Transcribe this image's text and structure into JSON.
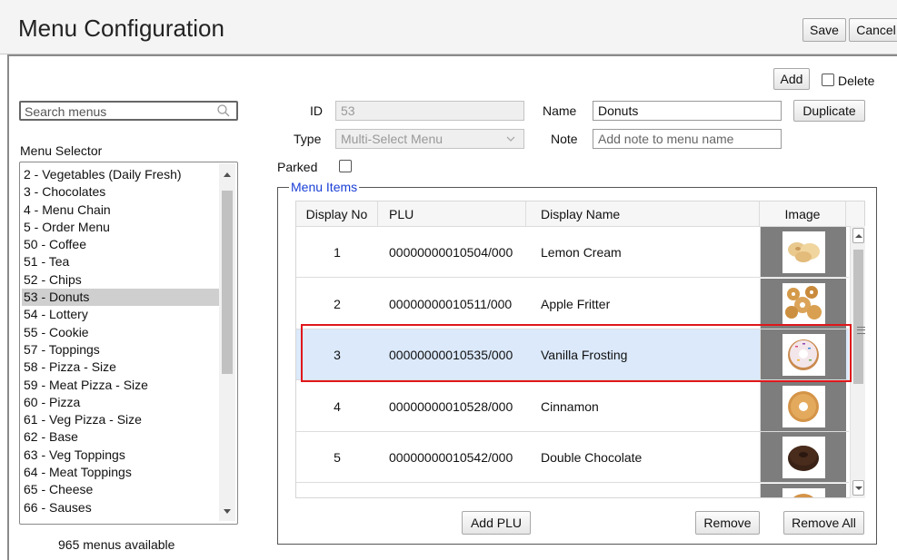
{
  "header": {
    "title": "Menu Configuration",
    "save_label": "Save",
    "cancel_label": "Cancel"
  },
  "sidebar": {
    "search_placeholder": "Search menus",
    "selector_label": "Menu Selector",
    "selected_index": 7,
    "menus": [
      "2 - Vegetables (Daily Fresh)",
      "3 - Chocolates",
      "4 - Menu Chain",
      "5 - Order Menu",
      "50 - Coffee",
      "51 - Tea",
      "52 - Chips",
      "53 - Donuts",
      "54 - Lottery",
      "55 - Cookie",
      "57 - Toppings",
      "58 - Pizza - Size",
      "59 - Meat Pizza - Size",
      "60 - Pizza",
      "61 - Veg Pizza - Size",
      "62 - Base",
      "63 - Veg Toppings",
      "64 - Meat Toppings",
      "65 - Cheese",
      "66 - Sauses"
    ],
    "count_text": "965 menus available"
  },
  "form": {
    "add_label": "Add",
    "delete_label": "Delete",
    "id_label": "ID",
    "id_value": "53",
    "name_label": "Name",
    "name_value": "Donuts",
    "duplicate_label": "Duplicate",
    "type_label": "Type",
    "type_value": "Multi-Select Menu",
    "note_label": "Note",
    "note_placeholder": "Add note to menu name",
    "parked_label": "Parked"
  },
  "menu_items": {
    "legend": "Menu Items",
    "columns": {
      "display_no": "Display No",
      "plu": "PLU",
      "display_name": "Display Name",
      "image": "Image"
    },
    "rows": [
      {
        "display_no": "1",
        "plu": "00000000010504/000",
        "display_name": "Lemon Cream",
        "image": "lemon-cream-donut-image",
        "selected": false
      },
      {
        "display_no": "2",
        "plu": "00000000010511/000",
        "display_name": "Apple Fritter",
        "image": "apple-fritter-donut-image",
        "selected": false
      },
      {
        "display_no": "3",
        "plu": "00000000010535/000",
        "display_name": "Vanilla Frosting",
        "image": "vanilla-frosting-donut-image",
        "selected": true
      },
      {
        "display_no": "4",
        "plu": "00000000010528/000",
        "display_name": "Cinnamon",
        "image": "cinnamon-donut-image",
        "selected": false
      },
      {
        "display_no": "5",
        "plu": "00000000010542/000",
        "display_name": "Double Chocolate",
        "image": "double-chocolate-donut-image",
        "selected": false
      }
    ],
    "add_plu_label": "Add PLU",
    "remove_label": "Remove",
    "remove_all_label": "Remove All"
  },
  "colors": {
    "selected_row": "#dbe9fb",
    "highlight_border": "#e0171b",
    "legend_text": "#1a3fd6",
    "selected_menu": "#cfcfcf"
  }
}
